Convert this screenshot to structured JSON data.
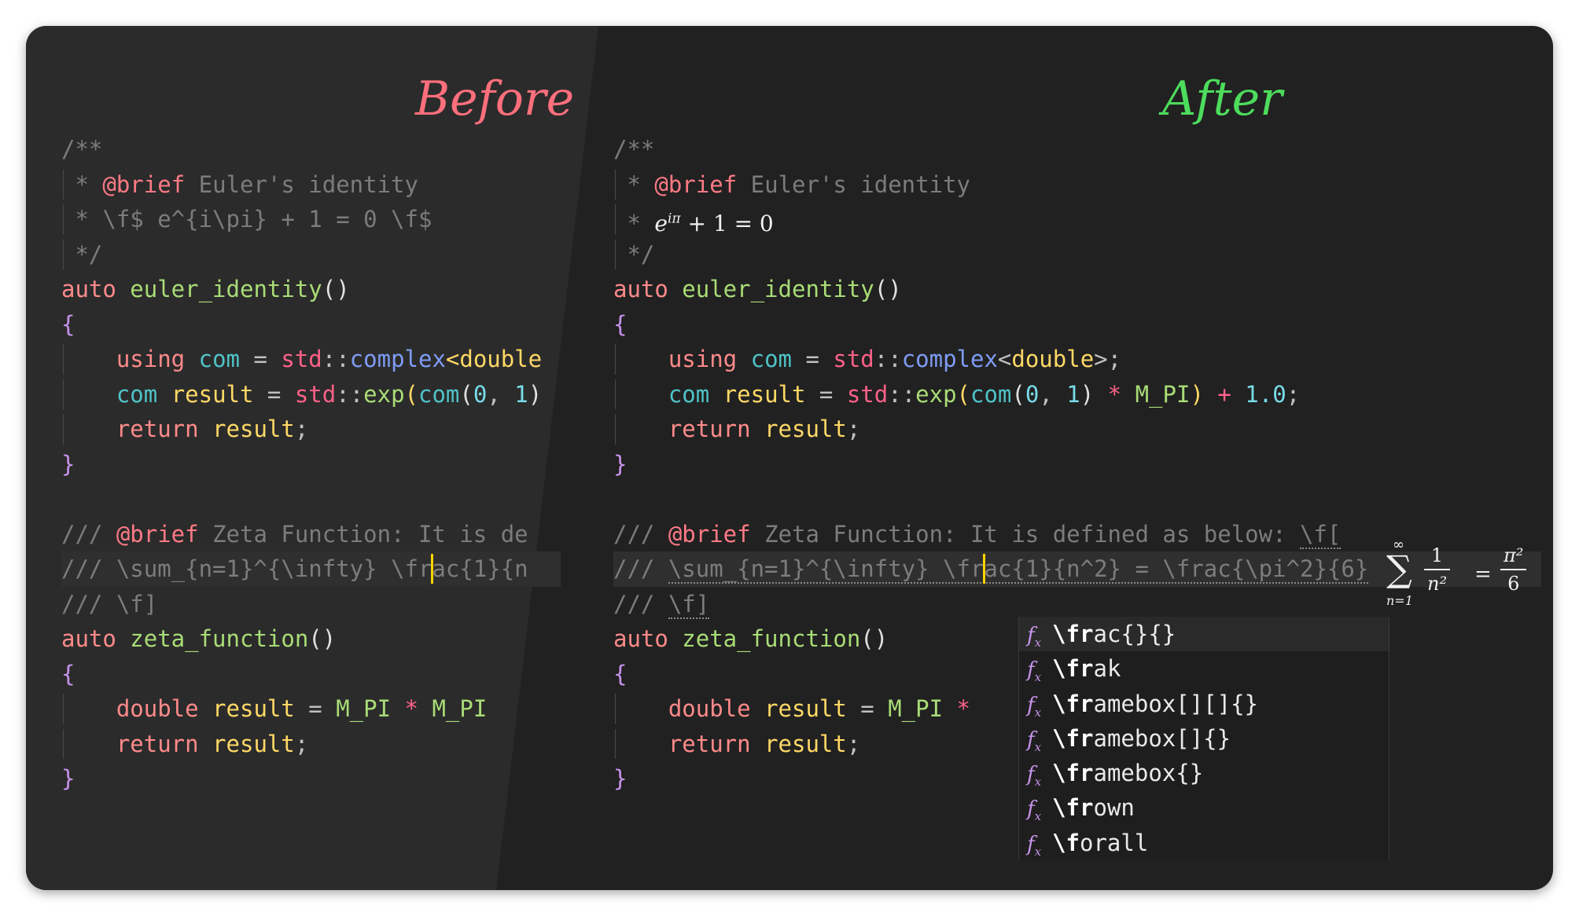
{
  "labels": {
    "before": "Before",
    "after": "After",
    "before_color": "#ff6f7c",
    "after_color": "#4ddc5c"
  },
  "colors": {
    "comment": "#7c7c7c",
    "keyword": "#ff8a8a",
    "function": "#a9dc76",
    "type": "#4fc3c8",
    "variable": "#ffd866",
    "namespace": "#ff6188",
    "class": "#7f9cf5",
    "number": "#78dce8",
    "operator": "#c0c0c0",
    "brace": "#c792ea",
    "macro": "#a9dc76",
    "tag": "#ff7a85",
    "cursor": "#ffd400"
  },
  "before_code": {
    "l1": "/**",
    "l2_star": " * ",
    "l2_tag": "@brief",
    "l2_text": " Euler's identity",
    "l3": " * \\f$ e^{i\\pi} + 1 = 0 \\f$",
    "l4": " */",
    "l5_kw": "auto",
    "l5_fn": " euler_identity",
    "l5_paren": "()",
    "l6": "{",
    "l7_kw": "using",
    "l7_type": " com",
    "l7_eq": " = ",
    "l7_ns": "std",
    "l7_sep": "::",
    "l7_cls": "complex",
    "l7_rest": "<double",
    "l8_type": "com",
    "l8_var": " result",
    "l8_eq": " = ",
    "l8_ns": "std",
    "l8_sep": "::",
    "l8_fn": "exp",
    "l8_p1": "(",
    "l8_type2": "com",
    "l8_p2": "(",
    "l8_n0": "0",
    "l8_comma": ", ",
    "l8_n1": "1",
    "l8_p3": ")",
    "l9_kw": "return",
    "l9_var": " result",
    "l9_semi": ";",
    "l10": "}",
    "l12_pre": "/// ",
    "l12_tag": "@brief",
    "l12_text": " Zeta Function: It is de",
    "l13_a": "/// \\sum_{n=1}^{\\infty} \\fr",
    "l13_b": "ac{1}{n",
    "l14": "/// \\f]",
    "l15_kw": "auto",
    "l15_fn": " zeta_function",
    "l15_paren": "()",
    "l16": "{",
    "l17_kw": "double",
    "l17_var": " result",
    "l17_eq": " = ",
    "l17_m1": "M_PI",
    "l17_op": " * ",
    "l17_m2": "M_PI",
    "l18_kw": "return",
    "l18_var": " result",
    "l18_semi": ";",
    "l19": "}"
  },
  "after_code": {
    "l1": "/**",
    "l2_star": " * ",
    "l2_tag": "@brief",
    "l2_text": " Euler's identity",
    "l3_star": " * ",
    "l3_math_e": "e",
    "l3_math_sup": "iπ",
    "l3_math_rest": " + 1 = 0",
    "l4": " */",
    "l5_kw": "auto",
    "l5_fn": " euler_identity",
    "l5_paren": "()",
    "l6": "{",
    "l7_kw": "using",
    "l7_type": " com",
    "l7_eq": " = ",
    "l7_ns": "std",
    "l7_sep": "::",
    "l7_cls": "complex",
    "l7_lt": "<",
    "l7_dbl": "double",
    "l7_gt": ">",
    "l7_semi": ";",
    "l8_type": "com",
    "l8_var": " result",
    "l8_eq": " = ",
    "l8_ns": "std",
    "l8_sep": "::",
    "l8_fn": "exp",
    "l8_p1": "(",
    "l8_type2": "com",
    "l8_p2": "(",
    "l8_n0": "0",
    "l8_comma": ", ",
    "l8_n1": "1",
    "l8_p3": ")",
    "l8_op": " * ",
    "l8_mpi": "M_PI",
    "l8_p4": ")",
    "l8_plus": " + ",
    "l8_num": "1.0",
    "l8_semi": ";",
    "l9_kw": "return",
    "l9_var": " result",
    "l9_semi": ";",
    "l10": "}",
    "l12_pre": "/// ",
    "l12_tag": "@brief",
    "l12_text": " Zeta Function: It is defined as below: ",
    "l12_fopen": "\\f[",
    "l13_pre": "/// ",
    "l13_a": "\\sum_{n=1}^{\\infty} \\fr",
    "l13_b": "ac{1}{n^2} = \\frac{\\pi^2}{6}",
    "l14_pre": "/// ",
    "l14_fclose": "\\f]",
    "l15_kw": "auto",
    "l15_fn": " zeta_function",
    "l15_paren": "()",
    "l16": "{",
    "l17_kw": "double",
    "l17_var": " result",
    "l17_eq": " = ",
    "l17_m1": "M_PI",
    "l17_op": " *",
    "l18_kw": "return",
    "l18_var": " result",
    "l18_semi": ";",
    "l19": "}"
  },
  "math_preview": {
    "sum_symbol": "∑",
    "sum_sup": "∞",
    "sum_sub": "n=1",
    "frac1_num": "1",
    "frac1_den": "n²",
    "equals": "=",
    "frac2_num": "π²",
    "frac2_den": "6"
  },
  "completion": {
    "icon": "f",
    "icon_sub": "x",
    "items": [
      {
        "match": "\\fr",
        "rest": "ac{}{}"
      },
      {
        "match": "\\fr",
        "rest": "ak"
      },
      {
        "match": "\\fr",
        "rest": "amebox[][]{}"
      },
      {
        "match": "\\fr",
        "rest": "amebox[]{}"
      },
      {
        "match": "\\fr",
        "rest": "amebox{}"
      },
      {
        "match": "\\fr",
        "rest": "own"
      },
      {
        "match": "\\f",
        "rest": "orall"
      }
    ]
  }
}
